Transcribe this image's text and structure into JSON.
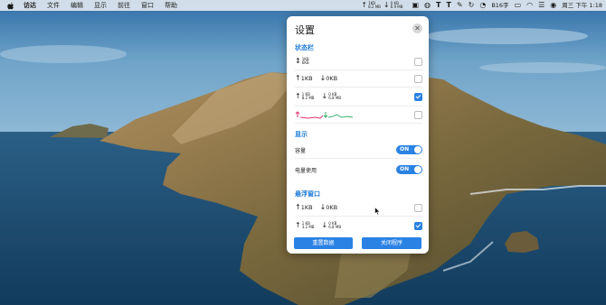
{
  "menubar": {
    "apple_icon": "apple-icon",
    "items": [
      "访达",
      "文件",
      "编辑",
      "显示",
      "前往",
      "窗口",
      "帮助"
    ],
    "net_up": [
      "1KB",
      "8.2 MB"
    ],
    "net_down": [
      "0 KB",
      "6.9 MB"
    ],
    "tray_text": "B16字",
    "clock": "周三 下午 1:18"
  },
  "panel": {
    "title": "设置",
    "close_icon": "close-icon",
    "statusbar": {
      "title": "状态栏",
      "rows": [
        {
          "kind": "stacked-single",
          "top": "1KB",
          "bottom": "6KB",
          "checked": false
        },
        {
          "kind": "inline",
          "up": "1KB",
          "down": "0KB",
          "checked": false
        },
        {
          "kind": "stacked-pair",
          "up": [
            "1 KB",
            "8.2 MB"
          ],
          "down": [
            "0 KB",
            "6.8 MB"
          ],
          "checked": true
        },
        {
          "kind": "graph",
          "checked": false
        }
      ]
    },
    "display": {
      "title": "显示",
      "rows": [
        {
          "label": "容量",
          "toggle": "ON"
        },
        {
          "label": "电量使用",
          "toggle": "ON"
        }
      ]
    },
    "floating": {
      "title": "悬浮窗口",
      "rows": [
        {
          "kind": "inline",
          "up": "1KB",
          "down": "0KB",
          "checked": false
        },
        {
          "kind": "stacked-pair",
          "up": [
            "1 KB",
            "3.2 MB"
          ],
          "down": [
            "0 KB",
            "6.8 MB"
          ],
          "checked": true
        }
      ]
    },
    "buttons": {
      "reset": "重置数据",
      "quit": "关闭程序"
    }
  },
  "colors": {
    "accent": "#2a82e4",
    "graph_up": "#e2336b",
    "graph_down": "#2fb06a"
  }
}
